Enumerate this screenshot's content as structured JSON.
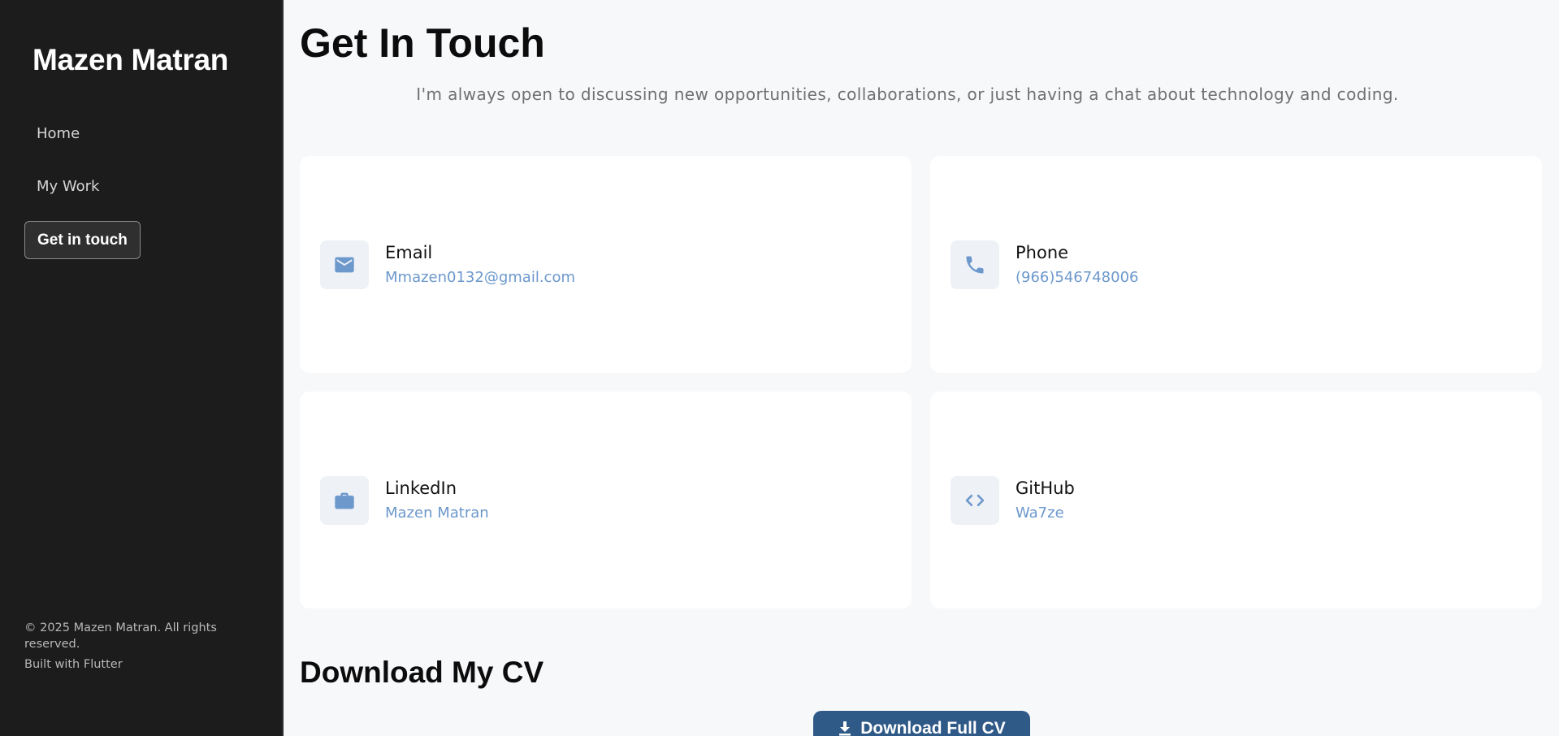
{
  "sidebar": {
    "brand": "Mazen Matran",
    "nav": [
      {
        "label": "Home"
      },
      {
        "label": "My Work"
      },
      {
        "label": "Get in touch"
      }
    ],
    "footer": {
      "copyright": "© 2025 Mazen Matran. All rights reserved.",
      "built_with": "Built with Flutter"
    }
  },
  "main": {
    "title": "Get In Touch",
    "subtitle": "I'm always open to discussing new opportunities, collaborations, or just having a chat about technology and coding.",
    "contacts": [
      {
        "label": "Email",
        "value": "Mmazen0132@gmail.com",
        "icon": "envelope-icon"
      },
      {
        "label": "Phone",
        "value": "(966)546748006",
        "icon": "phone-icon"
      },
      {
        "label": "LinkedIn",
        "value": "Mazen Matran",
        "icon": "briefcase-icon"
      },
      {
        "label": "GitHub",
        "value": "Wa7ze",
        "icon": "code-icon"
      }
    ],
    "cv": {
      "title": "Download My CV",
      "button_label": "Download Full CV"
    }
  },
  "colors": {
    "sidebar_bg": "#1c1c1c",
    "accent": "#6c98cc",
    "button_bg": "#2f5987",
    "page_bg": "#f7f8fa"
  }
}
